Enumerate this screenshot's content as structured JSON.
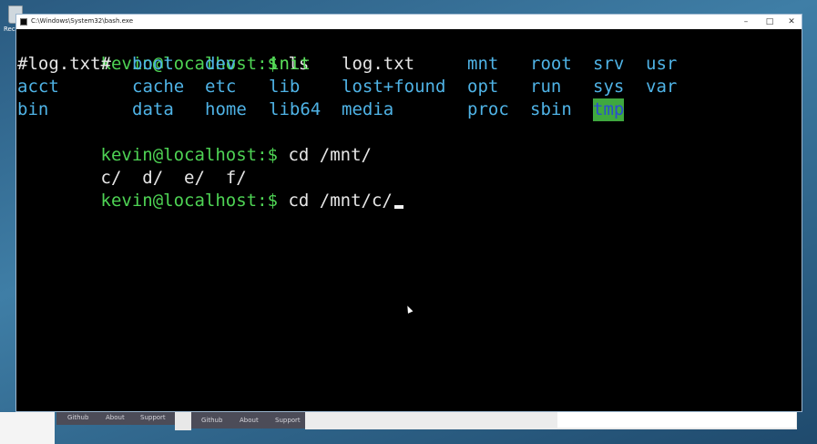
{
  "desktop": {
    "recycle_label": "Recyc"
  },
  "background_page": {
    "nav_top": [
      "Github",
      "About",
      "Support"
    ],
    "nav_bottom": [
      "Github",
      "About",
      "Support"
    ]
  },
  "window": {
    "title": "C:\\Windows\\System32\\bash.exe",
    "minimize": "–",
    "maximize": "□",
    "close": "✕"
  },
  "terminal": {
    "prompt": "kevin@localhost:$",
    "commands": [
      "ls",
      "cd /mnt/",
      "cd /mnt/c/"
    ],
    "ls_rows": [
      [
        {
          "text": "#log.txt#",
          "kind": "plain"
        },
        {
          "text": "boot",
          "kind": "dir"
        },
        {
          "text": "dev",
          "kind": "dir"
        },
        {
          "text": "init",
          "kind": "exe"
        },
        {
          "text": "log.txt",
          "kind": "plain"
        },
        {
          "text": "mnt",
          "kind": "dir"
        },
        {
          "text": "root",
          "kind": "dir"
        },
        {
          "text": "srv",
          "kind": "dir"
        },
        {
          "text": "usr",
          "kind": "dir"
        }
      ],
      [
        {
          "text": "acct",
          "kind": "dir"
        },
        {
          "text": "cache",
          "kind": "dir"
        },
        {
          "text": "etc",
          "kind": "dir"
        },
        {
          "text": "lib",
          "kind": "dir"
        },
        {
          "text": "lost+found",
          "kind": "dir"
        },
        {
          "text": "opt",
          "kind": "dir"
        },
        {
          "text": "run",
          "kind": "dir"
        },
        {
          "text": "sys",
          "kind": "dir"
        },
        {
          "text": "var",
          "kind": "dir"
        }
      ],
      [
        {
          "text": "bin",
          "kind": "dir"
        },
        {
          "text": "data",
          "kind": "dir"
        },
        {
          "text": "home",
          "kind": "dir"
        },
        {
          "text": "lib64",
          "kind": "dir"
        },
        {
          "text": "media",
          "kind": "dir"
        },
        {
          "text": "proc",
          "kind": "dir"
        },
        {
          "text": "sbin",
          "kind": "dir"
        },
        {
          "text": "tmp",
          "kind": "hl"
        }
      ]
    ],
    "completion_output": "c/  d/  e/  f/"
  },
  "colors": {
    "prompt": "#4ed354",
    "directory": "#4fb3e6",
    "executable": "#5ae05a",
    "sticky_dir_bg": "#3fa83f",
    "sticky_dir_fg": "#2b4dd0",
    "terminal_bg": "#000000"
  }
}
